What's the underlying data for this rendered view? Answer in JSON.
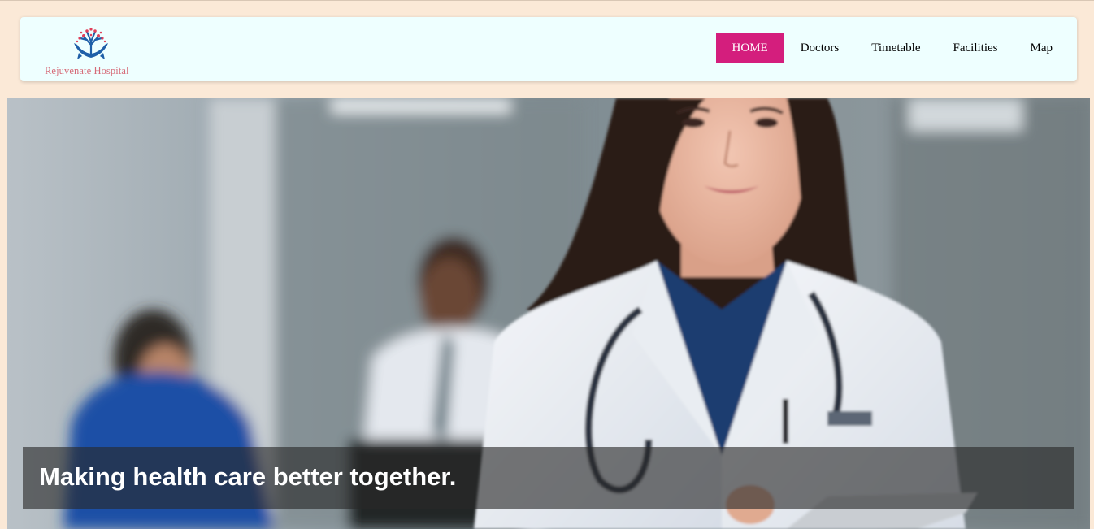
{
  "brand": {
    "logo_text": "Rejuvenate Hospital",
    "logo_icon": "tree-in-hands-icon"
  },
  "nav": {
    "items": [
      {
        "label": "HOME",
        "active": true
      },
      {
        "label": "Doctors",
        "active": false
      },
      {
        "label": "Timetable",
        "active": false
      },
      {
        "label": "Facilities",
        "active": false
      },
      {
        "label": "Map",
        "active": false
      }
    ]
  },
  "hero": {
    "image": "female-doctor-with-stethoscope-photo",
    "caption": "Making health care better together."
  },
  "colors": {
    "page_background": "#fbe9d7",
    "navbar_background": "#eeffff",
    "nav_active": "#d41e7d",
    "logo_text": "#d66a77"
  }
}
